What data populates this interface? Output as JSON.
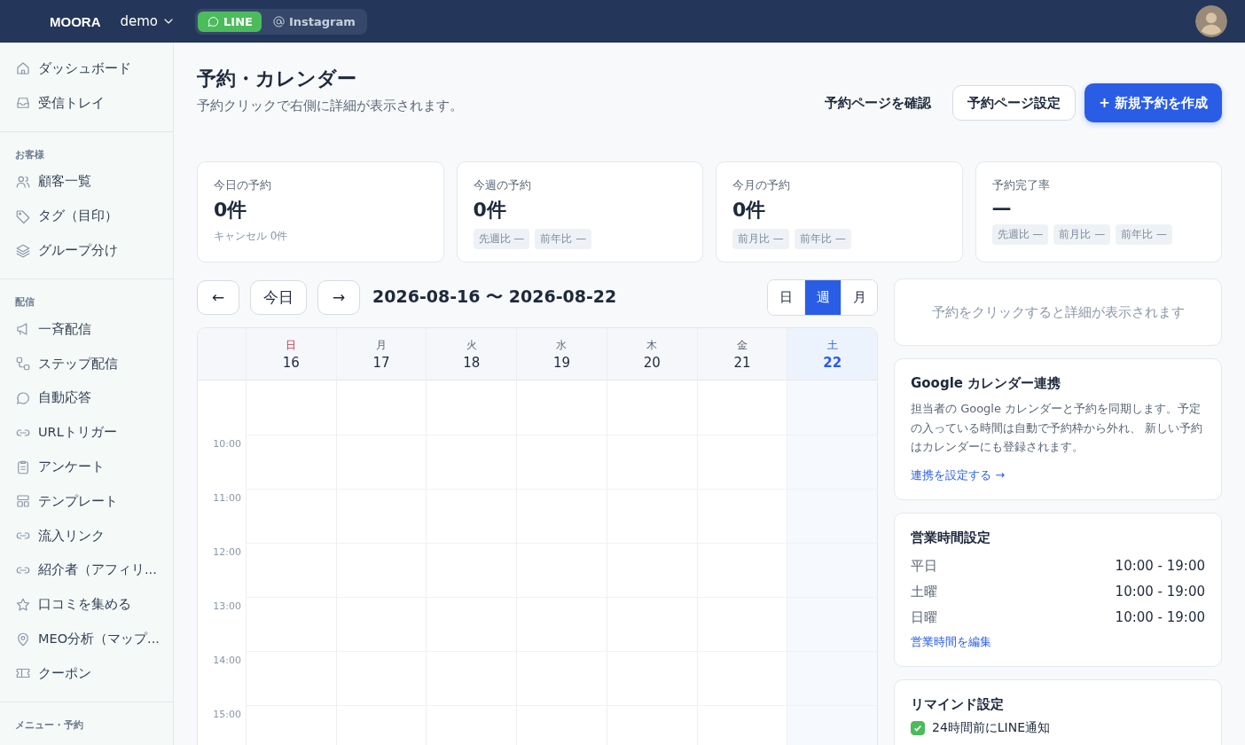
{
  "topbar": {
    "brand": "MOORA",
    "workspace": "demo",
    "channels": [
      {
        "label": "LINE",
        "selected": true
      },
      {
        "label": "Instagram",
        "selected": false
      }
    ]
  },
  "sidebar": {
    "sections": [
      {
        "items": [
          {
            "label": "ダッシュボード"
          },
          {
            "label": "受信トレイ"
          }
        ]
      },
      {
        "heading": "お客様",
        "items": [
          {
            "label": "顧客一覧"
          },
          {
            "label": "タグ（目印）"
          },
          {
            "label": "グループ分け"
          }
        ]
      },
      {
        "heading": "配信",
        "items": [
          {
            "label": "一斉配信"
          },
          {
            "label": "ステップ配信"
          },
          {
            "label": "自動応答"
          },
          {
            "label": "URLトリガー"
          },
          {
            "label": "アンケート"
          },
          {
            "label": "テンプレート"
          },
          {
            "label": "流入リンク"
          },
          {
            "label": "紹介者（アフィリ..."
          },
          {
            "label": "口コミを集める"
          },
          {
            "label": "MEO分析（マップ..."
          },
          {
            "label": "クーポン"
          }
        ]
      },
      {
        "heading": "メニュー・予約"
      }
    ]
  },
  "page": {
    "title": "予約・カレンダー",
    "subtitle": "予約クリックで右側に詳細が表示されます。",
    "actions": [
      {
        "label": "予約ページを確認",
        "kind": "link"
      },
      {
        "label": "予約ページ設定",
        "kind": "outline"
      },
      {
        "label": "+ 新規予約を作成",
        "kind": "primary"
      }
    ]
  },
  "stats": [
    {
      "label": "今日の予約",
      "value": "0件",
      "note": "キャンセル 0件"
    },
    {
      "label": "今週の予約",
      "value": "0件",
      "chips": [
        "先週比 —",
        "前年比 —"
      ]
    },
    {
      "label": "今月の予約",
      "value": "0件",
      "chips": [
        "前月比 —",
        "前年比 —"
      ]
    },
    {
      "label": "予約完了率",
      "value": "—",
      "chips": [
        "先週比 —",
        "前月比 —",
        "前年比 —"
      ]
    }
  ],
  "calendar": {
    "prev": "←",
    "today": "今日",
    "next": "→",
    "range": "2026-08-16 〜 2026-08-22",
    "views": [
      {
        "label": "日",
        "selected": false
      },
      {
        "label": "週",
        "selected": true
      },
      {
        "label": "月",
        "selected": false
      }
    ],
    "days": [
      {
        "dow": "日",
        "date": "16",
        "kind": "sun",
        "selected": false
      },
      {
        "dow": "月",
        "date": "17",
        "kind": "weekday",
        "selected": false
      },
      {
        "dow": "火",
        "date": "18",
        "kind": "weekday",
        "selected": false
      },
      {
        "dow": "水",
        "date": "19",
        "kind": "weekday",
        "selected": false
      },
      {
        "dow": "木",
        "date": "20",
        "kind": "weekday",
        "selected": false
      },
      {
        "dow": "金",
        "date": "21",
        "kind": "weekday",
        "selected": false
      },
      {
        "dow": "土",
        "date": "22",
        "kind": "sat",
        "selected": true
      }
    ],
    "hours": [
      "10:00",
      "11:00",
      "12:00",
      "13:00",
      "14:00",
      "15:00"
    ]
  },
  "detail": {
    "placeholder": "予約をクリックすると詳細が表示されます"
  },
  "google": {
    "title": "Google カレンダー連携",
    "text": "担当者の Google カレンダーと予約を同期します。予定の入っている時間は自動で予約枠から外れ、 新しい予約はカレンダーにも登録されます。",
    "link": "連携を設定する →"
  },
  "hours_card": {
    "title": "営業時間設定",
    "rows": [
      {
        "day": "平日",
        "time": "10:00 - 19:00"
      },
      {
        "day": "土曜",
        "time": "10:00 - 19:00"
      },
      {
        "day": "日曜",
        "time": "10:00 - 19:00"
      }
    ],
    "link": "営業時間を編集"
  },
  "remind": {
    "title": "リマインド設定",
    "options": [
      {
        "label": "24時間前にLINE通知",
        "checked": true
      }
    ]
  }
}
